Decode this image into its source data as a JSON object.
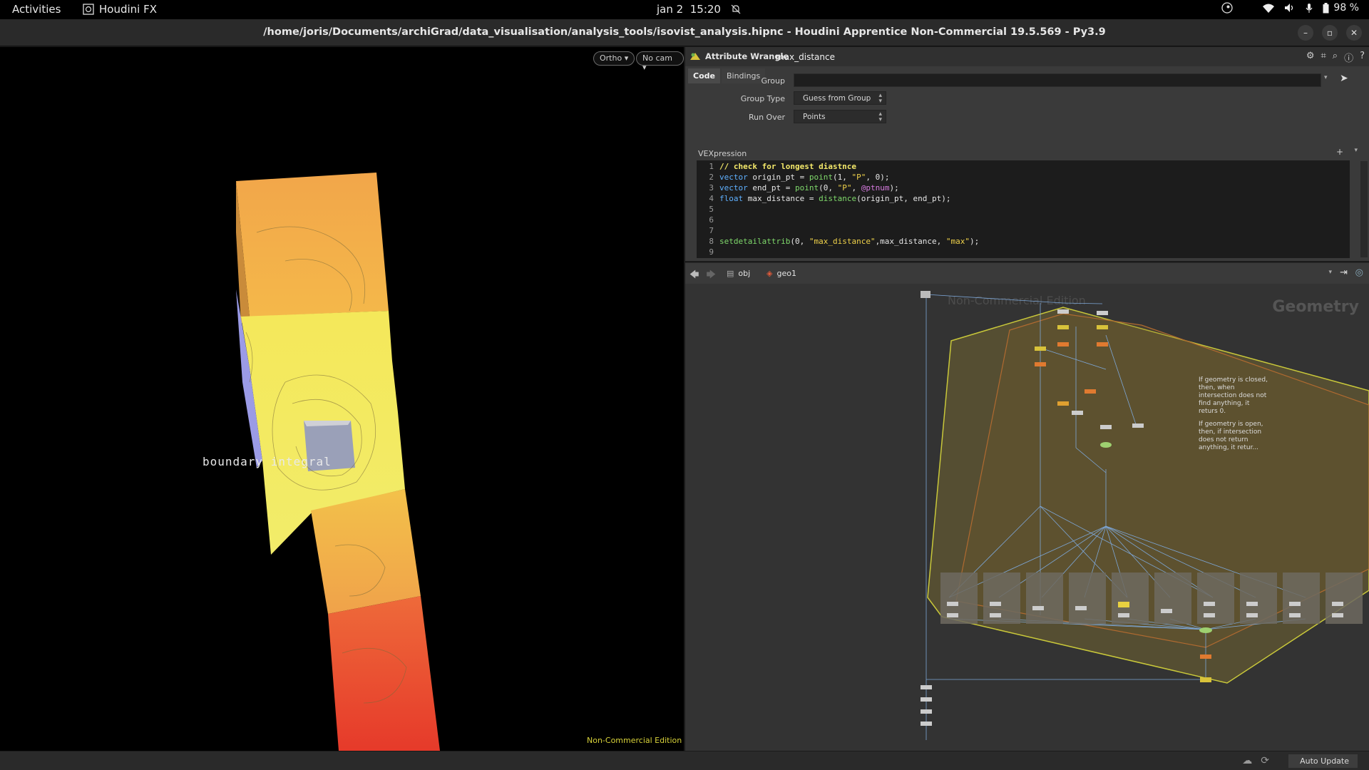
{
  "topbar": {
    "activities": "Activities",
    "app_name": "Houdini FX",
    "date": "jan 2",
    "time": "15:20",
    "battery": "98 %"
  },
  "window": {
    "title": "/home/joris/Documents/archiGrad/data_visualisation/analysis_tools/isovist_analysis.hipnc - Houdini Apprentice Non-Commercial 19.5.569 - Py3.9"
  },
  "viewport": {
    "projection": "Ortho",
    "camera": "No cam",
    "overlay_label": "boundary integral",
    "edition": "Non-Commercial Edition"
  },
  "params": {
    "op_type": "Attribute Wrangle",
    "node_name": "max_distance",
    "tabs": [
      "Code",
      "Bindings"
    ],
    "active_tab": "Code",
    "group_label": "Group",
    "group_value": "",
    "group_type_label": "Group Type",
    "group_type_value": "Guess from Group",
    "run_over_label": "Run Over",
    "run_over_value": "Points",
    "vex_label": "VEXpression",
    "code_line_numbers": [
      "1",
      "2",
      "3",
      "4",
      "5",
      "6",
      "7",
      "8",
      "9"
    ]
  },
  "network": {
    "path_obj": "obj",
    "path_geo": "geo1",
    "context_label": "Geometry",
    "ghost_label": "Non-Commercial Edition",
    "sticky_note_1": "If geometry is closed, then, when intersection does not find anything, it returs 0.",
    "sticky_note_2": "If geometry is open, then, if intersection does not return anything, it retur..."
  },
  "status": {
    "auto_update": "Auto Update"
  },
  "colors": {
    "accent_yellow": "#d8d23a",
    "vex_keyword": "#5fb0ff",
    "vex_function": "#7fd96b",
    "vex_string": "#f0d24a"
  }
}
